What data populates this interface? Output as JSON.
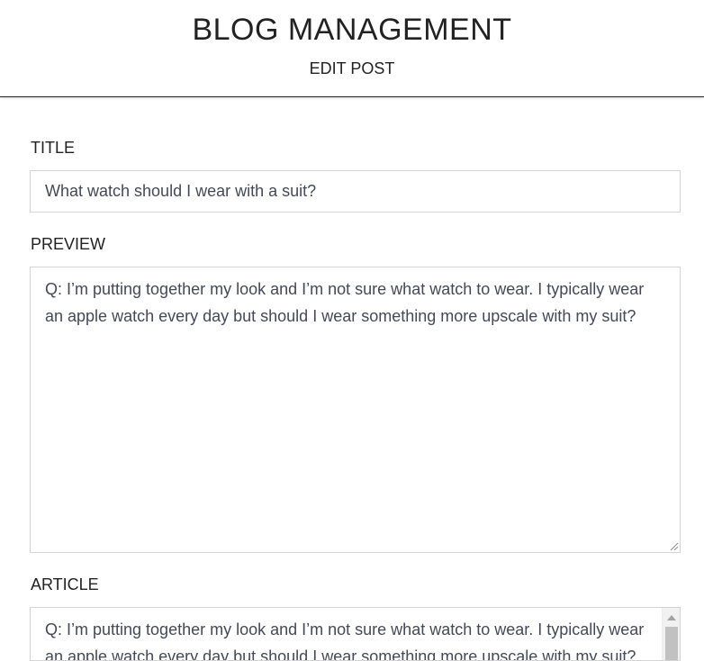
{
  "header": {
    "title": "BLOG MANAGEMENT",
    "subtitle": "EDIT POST"
  },
  "form": {
    "title_label": "TITLE",
    "title_value": "What watch should I wear with a suit?",
    "preview_label": "PREVIEW",
    "preview_value": "Q: I’m putting together my look and I’m not sure what watch to wear. I typically wear an apple watch every day but should I wear something more upscale with my suit?",
    "article_label": "ARTICLE",
    "article_value": "Q: I’m putting together my look and I’m not sure what watch to wear. I typically wear an apple watch every day but should I wear something more upscale with my suit?"
  },
  "colors": {
    "text": "#222222",
    "field_text": "#444a55",
    "border": "#d4d4d4"
  },
  "icons": [
    "resize-grip-icon",
    "scroll-up-arrow-icon"
  ]
}
